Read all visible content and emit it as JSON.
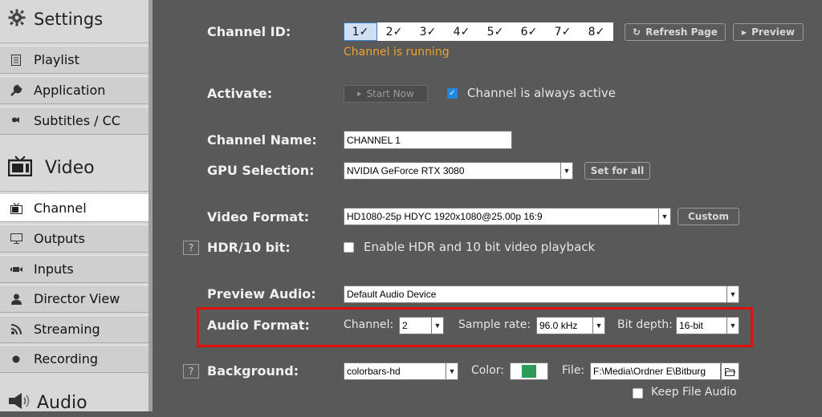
{
  "sidebar": {
    "settings_title": "Settings",
    "video_title": "Video",
    "audio_title": "Audio",
    "settings_items": [
      {
        "label": "Playlist",
        "icon": "playlist-icon"
      },
      {
        "label": "Application",
        "icon": "wrench-icon"
      },
      {
        "label": "Subtitles / CC",
        "icon": "subtitles-icon"
      }
    ],
    "video_items": [
      {
        "label": "Channel",
        "icon": "tv-icon",
        "active": true
      },
      {
        "label": "Outputs",
        "icon": "monitor-icon"
      },
      {
        "label": "Inputs",
        "icon": "camera-icon"
      },
      {
        "label": "Director View",
        "icon": "user-icon"
      },
      {
        "label": "Streaming",
        "icon": "wifi-icon"
      },
      {
        "label": "Recording",
        "icon": "record-icon"
      }
    ]
  },
  "channel": {
    "label": "Channel ID:",
    "tabs": [
      "1✓",
      "2✓",
      "3✓",
      "4✓",
      "5✓",
      "6✓",
      "7✓",
      "8✓"
    ],
    "active_tab": 0,
    "status": "Channel is running",
    "status_color": "#f0a030",
    "refresh_label": "Refresh Page",
    "preview_label": "Preview"
  },
  "activate": {
    "label": "Activate:",
    "start_label": "Start Now",
    "always_active_label": "Channel is always active",
    "always_active_checked": true
  },
  "channel_name": {
    "label": "Channel Name:",
    "value": "CHANNEL 1"
  },
  "gpu": {
    "label": "GPU Selection:",
    "value": "NVIDIA GeForce RTX 3080",
    "set_all_label": "Set for all"
  },
  "video_format": {
    "label": "Video Format:",
    "value": "HD1080-25p HDYC 1920x1080@25.00p 16:9",
    "custom_label": "Custom"
  },
  "hdr": {
    "label": "HDR/10 bit:",
    "help": "?",
    "checkbox_label": "Enable HDR and 10 bit video playback",
    "checked": false
  },
  "preview_audio": {
    "label": "Preview Audio:",
    "value": "Default Audio Device"
  },
  "audio_format": {
    "label": "Audio Format:",
    "channel_label": "Channel:",
    "channel_value": "2",
    "sample_rate_label": "Sample rate:",
    "sample_rate_value": "96.0 kHz",
    "bit_depth_label": "Bit depth:",
    "bit_depth_value": "16-bit",
    "highlight_color": "#e01010"
  },
  "background": {
    "label": "Background:",
    "help": "?",
    "value": "colorbars-hd",
    "color_label": "Color:",
    "color_value": "#2e9a58",
    "file_label": "File:",
    "file_value": "F:\\Media\\Ordner E\\Bitburg",
    "keep_audio_label": "Keep File Audio",
    "keep_audio_checked": false
  }
}
